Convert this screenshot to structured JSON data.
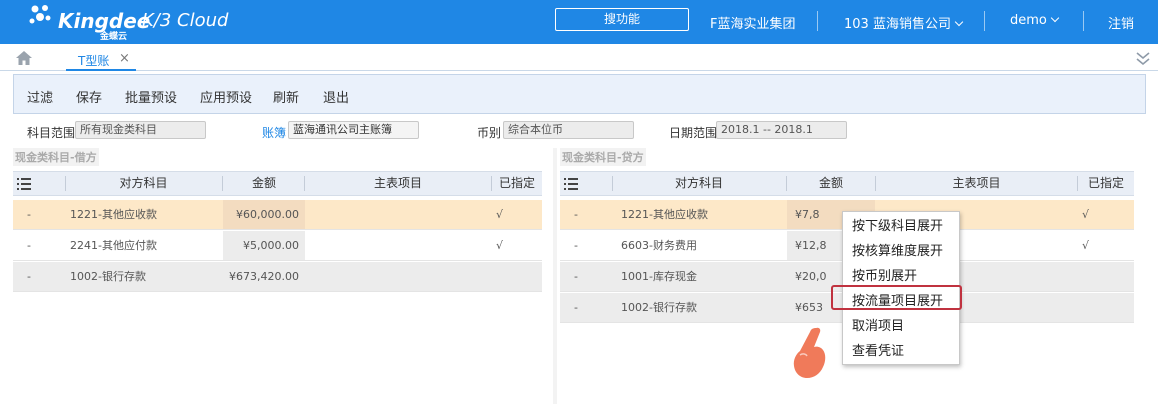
{
  "header": {
    "brand": "Kingdee",
    "brand_sub": "金蝶云",
    "product": "K/3 Cloud",
    "search_placeholder": "搜功能",
    "org": "F蓝海实业集团",
    "company": "103 蓝海销售公司",
    "user": "demo",
    "logout": "注销"
  },
  "tabs": {
    "active_label": "T型账",
    "close_glyph": "×"
  },
  "toolbar": {
    "buttons": [
      "过滤",
      "保存",
      "批量预设",
      "应用预设",
      "刷新",
      "退出"
    ]
  },
  "filters": {
    "scope_label": "科目范围",
    "scope_value": "所有现金类科目",
    "book_label": "账簿",
    "book_value": "蓝海通讯公司主账簿",
    "currency_label": "币别",
    "currency_value": "综合本位币",
    "date_label": "日期范围",
    "date_value": "2018.1 -- 2018.1"
  },
  "debit_panel": {
    "title": "现金类科目-借方",
    "columns": [
      "对方科目",
      "金额",
      "主表项目",
      "已指定"
    ],
    "rows": [
      {
        "dash": "-",
        "account": "1221-其他应收款",
        "amount": "¥60,000.00",
        "item": "",
        "assigned": "√"
      },
      {
        "dash": "-",
        "account": "2241-其他应付款",
        "amount": "¥5,000.00",
        "item": "",
        "assigned": "√"
      },
      {
        "dash": "-",
        "account": "1002-银行存款",
        "amount": "¥673,420.00",
        "item": "",
        "assigned": ""
      }
    ]
  },
  "credit_panel": {
    "title": "现金类科目-贷方",
    "columns": [
      "对方科目",
      "金额",
      "主表项目",
      "已指定"
    ],
    "rows": [
      {
        "dash": "-",
        "account": "1221-其他应收款",
        "amount": "¥7,8",
        "item": "",
        "assigned": "√"
      },
      {
        "dash": "-",
        "account": "6603-财务费用",
        "amount": "¥12,8",
        "item": "",
        "assigned": "√"
      },
      {
        "dash": "-",
        "account": "1001-库存现金",
        "amount": "¥20,0",
        "item": "",
        "assigned": ""
      },
      {
        "dash": "-",
        "account": "1002-银行存款",
        "amount": "¥653",
        "item": "",
        "assigned": ""
      }
    ]
  },
  "context_menu": {
    "items": [
      "按下级科目展开",
      "按核算维度展开",
      "按币别展开",
      "按流量项目展开",
      "取消项目",
      "查看凭证"
    ],
    "highlighted": "按流量项目展开"
  },
  "colors": {
    "brand_blue": "#1f87e5",
    "selected_row": "#fde8c8",
    "highlight_border": "#c0323f",
    "pointer": "#f07a5a"
  },
  "icons": [
    "kingdee-logo-icon",
    "home-icon",
    "close-icon",
    "collapse-icon",
    "list-settings-icon",
    "hand-pointer-icon"
  ]
}
